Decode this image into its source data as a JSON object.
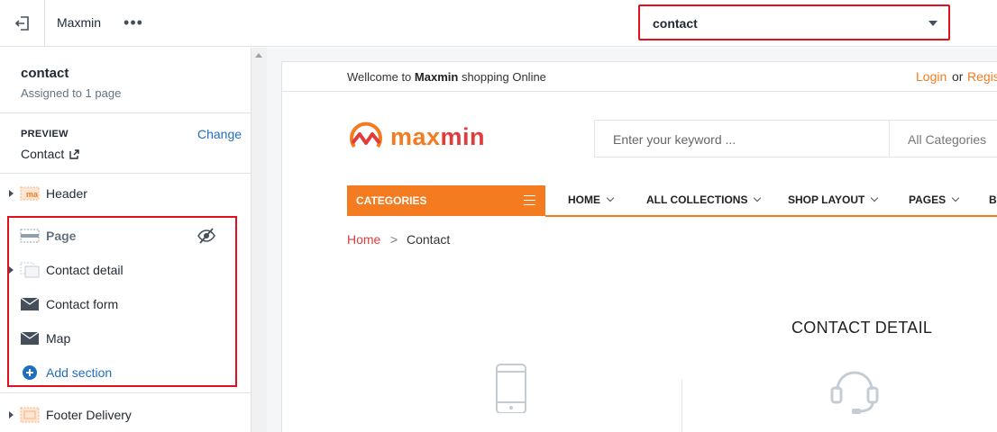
{
  "topbar": {
    "theme_name": "Maxmin",
    "more_label": "•••",
    "template_select": {
      "value": "contact"
    }
  },
  "sidebar": {
    "title": "contact",
    "subtitle": "Assigned to 1 page",
    "preview": {
      "label": "PREVIEW",
      "change": "Change",
      "value": "Contact"
    },
    "sections": [
      {
        "label": "Header"
      },
      {
        "label": "Page"
      },
      {
        "label": "Contact detail"
      },
      {
        "label": "Contact form"
      },
      {
        "label": "Map"
      },
      {
        "label": "Add section"
      },
      {
        "label": "Footer Delivery"
      }
    ]
  },
  "preview": {
    "welcome_prefix": "Wellcome to",
    "welcome_brand": "Maxmin",
    "welcome_suffix": "shopping Online",
    "login": "Login",
    "or": "or",
    "register": "Regis",
    "logo": {
      "part1": "max",
      "part2": "min"
    },
    "search_placeholder": "Enter your keyword ...",
    "search_category": "All Categories",
    "categories_button": "CATEGORIES",
    "nav": [
      "HOME",
      "ALL COLLECTIONS",
      "SHOP LAYOUT",
      "PAGES",
      "BL"
    ],
    "breadcrumb": {
      "home": "Home",
      "sep": ">",
      "current": "Contact"
    },
    "contact_detail_title": "CONTACT DETAIL"
  },
  "colors": {
    "accent": "#f47b20",
    "highlight": "#e30f1c",
    "link": "#1f6fc1"
  }
}
